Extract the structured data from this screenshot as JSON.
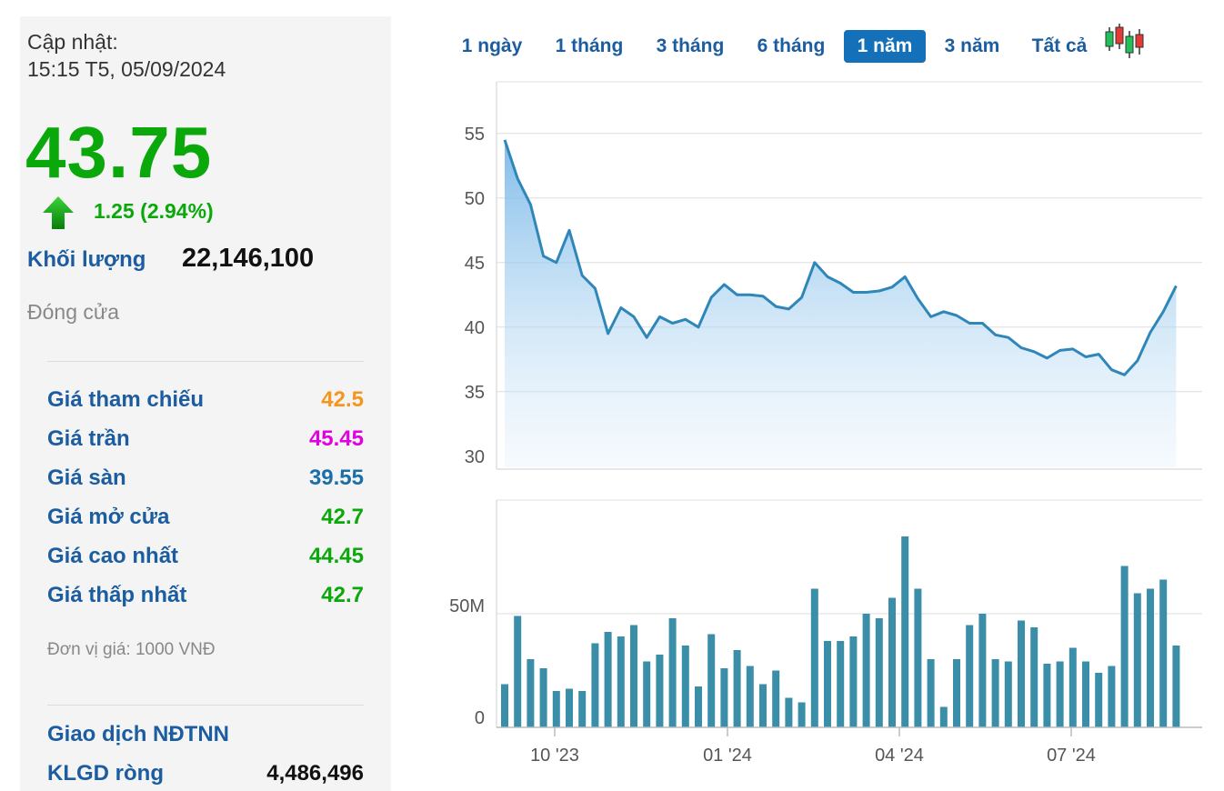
{
  "quote": {
    "updated_label": "Cập nhật:",
    "updated_time": "15:15 T5, 05/09/2024",
    "price": "43.75",
    "change": "1.25 (2.94%)",
    "volume_label": "Khối lượng",
    "volume_value": "22,146,100",
    "status": "Đóng cửa"
  },
  "stats": [
    {
      "label": "Giá tham chiếu",
      "value": "42.5",
      "color": "#f7941d"
    },
    {
      "label": "Giá trần",
      "value": "45.45",
      "color": "#e000e0"
    },
    {
      "label": "Giá sàn",
      "value": "39.55",
      "color": "#1b6fa8"
    },
    {
      "label": "Giá mở cửa",
      "value": "42.7",
      "color": "#0aa80a"
    },
    {
      "label": "Giá cao nhất",
      "value": "44.45",
      "color": "#0aa80a"
    },
    {
      "label": "Giá thấp nhất",
      "value": "42.7",
      "color": "#0aa80a"
    }
  ],
  "unit_note": "Đơn vị giá: 1000 VNĐ",
  "foreign": {
    "title": "Giao dịch NĐTNN",
    "net_label": "KLGD ròng",
    "net_value": "4,486,496"
  },
  "tabs": [
    {
      "label": "1 ngày",
      "active": false
    },
    {
      "label": "1 tháng",
      "active": false
    },
    {
      "label": "3 tháng",
      "active": false
    },
    {
      "label": "6 tháng",
      "active": false
    },
    {
      "label": "1 năm",
      "active": true
    },
    {
      "label": "3 năm",
      "active": false
    },
    {
      "label": "Tất cả",
      "active": false
    }
  ],
  "candlestick_icon": "candlestick-chart-icon",
  "colors": {
    "up": "#0aa80a",
    "label_blue": "#1b5da0",
    "active_tab": "#1470b8",
    "price_line": "#2f86b8",
    "volume_bar": "#3b8ea8"
  },
  "chart_data": [
    {
      "type": "area",
      "series": [
        {
          "values": [
            54.5,
            51.5,
            49.5,
            45.5,
            45.0,
            47.5,
            44.0,
            43.0,
            39.5,
            41.5,
            40.8,
            39.2,
            40.8,
            40.3,
            40.6,
            40.0,
            42.3,
            43.3,
            42.5,
            42.5,
            42.4,
            41.6,
            41.4,
            42.3,
            45.0,
            43.9,
            43.4,
            42.7,
            42.7,
            42.8,
            43.1,
            43.9,
            42.2,
            40.8,
            41.2,
            40.9,
            40.3,
            40.3,
            39.4,
            39.2,
            38.4,
            38.1,
            37.6,
            38.2,
            38.3,
            37.7,
            37.9,
            36.7,
            36.3,
            37.4,
            39.6,
            41.2,
            43.2
          ]
        }
      ],
      "x_ticks": [
        "10 '23",
        "01 '24",
        "04 '24",
        "07 '24"
      ],
      "y_ticks": [
        30,
        35,
        40,
        45,
        50,
        55
      ],
      "ylim": [
        29,
        59
      ],
      "grid": true
    },
    {
      "type": "bar",
      "series": [
        {
          "values": [
            19,
            49,
            30,
            26,
            16,
            17,
            16,
            37,
            42,
            40,
            45,
            29,
            32,
            48,
            36,
            18,
            41,
            26,
            34,
            27,
            19,
            25,
            13,
            11,
            61,
            38,
            38,
            40,
            50,
            48,
            57,
            84,
            61,
            30,
            9,
            30,
            45,
            50,
            30,
            29,
            47,
            44,
            28,
            29,
            35,
            29,
            24,
            27,
            71,
            59,
            61,
            65,
            36
          ]
        }
      ],
      "y_ticks": [
        "0",
        "50M"
      ],
      "y_tick_values": [
        0,
        50
      ],
      "ylim": [
        0,
        100
      ]
    }
  ]
}
